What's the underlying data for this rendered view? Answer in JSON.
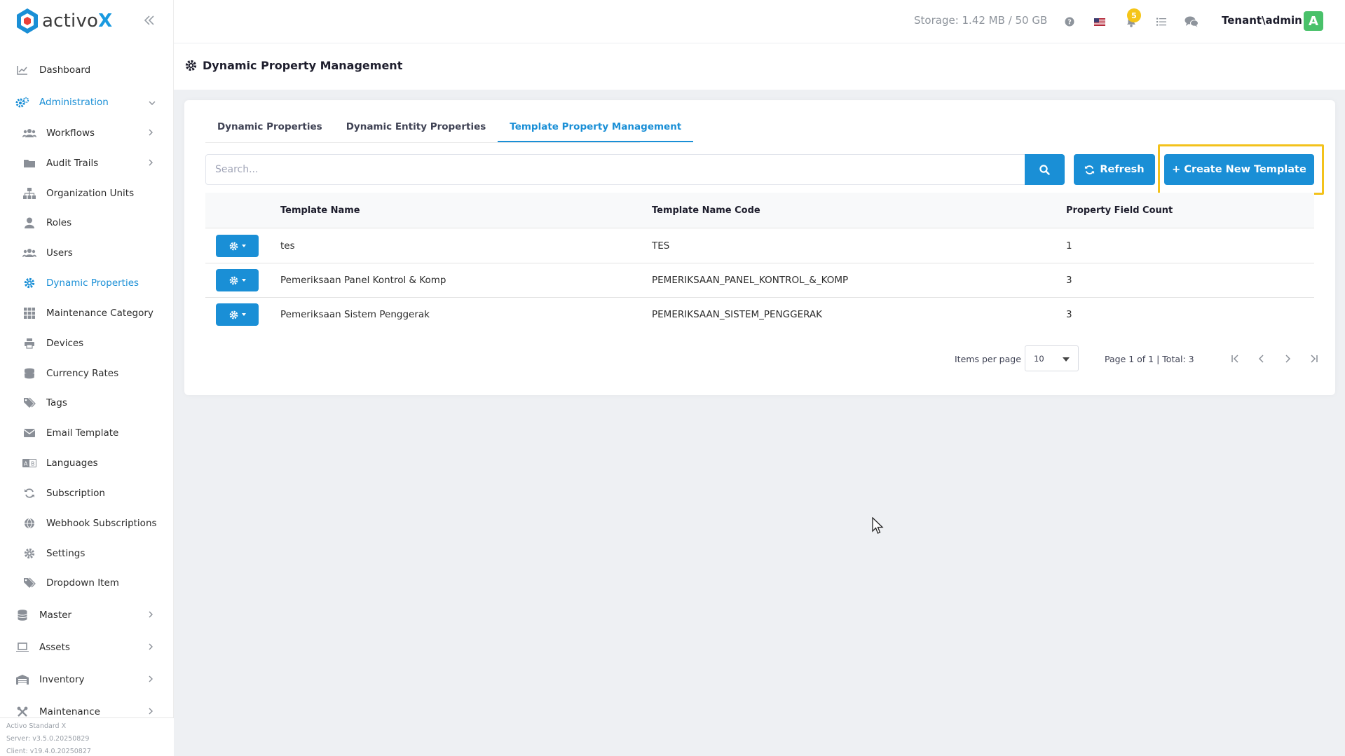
{
  "app": {
    "logo_text_prefix": "activo",
    "logo_text_suffix": "X",
    "brand_color": "#1a8fd6"
  },
  "sidebar": {
    "items": [
      {
        "label": "Dashboard",
        "icon": "chart-line-icon"
      },
      {
        "label": "Administration",
        "icon": "cogs-icon"
      },
      {
        "label": "Workflows",
        "icon": "users-icon"
      },
      {
        "label": "Audit Trails",
        "icon": "folder-icon"
      },
      {
        "label": "Organization Units",
        "icon": "sitemap-icon"
      },
      {
        "label": "Roles",
        "icon": "user-tie-icon"
      },
      {
        "label": "Users",
        "icon": "users-icon"
      },
      {
        "label": "Dynamic Properties",
        "icon": "gear-icon"
      },
      {
        "label": "Maintenance Category",
        "icon": "grid-icon"
      },
      {
        "label": "Devices",
        "icon": "printer-icon"
      },
      {
        "label": "Currency Rates",
        "icon": "coins-icon"
      },
      {
        "label": "Tags",
        "icon": "tags-icon"
      },
      {
        "label": "Email Template",
        "icon": "envelope-icon"
      },
      {
        "label": "Languages",
        "icon": "language-icon"
      },
      {
        "label": "Subscription",
        "icon": "sync-icon"
      },
      {
        "label": "Webhook Subscriptions",
        "icon": "globe-icon"
      },
      {
        "label": "Settings",
        "icon": "gear-icon"
      },
      {
        "label": "Dropdown Item",
        "icon": "tags-icon"
      },
      {
        "label": "Master",
        "icon": "database-icon"
      },
      {
        "label": "Assets",
        "icon": "laptop-icon"
      },
      {
        "label": "Inventory",
        "icon": "warehouse-icon"
      },
      {
        "label": "Maintenance",
        "icon": "tools-icon"
      }
    ],
    "footer": {
      "edition": "Activo Standard X",
      "server": "Server: v3.5.0.20250829",
      "client": "Client: v19.4.0.20250827"
    }
  },
  "topbar": {
    "storage": "Storage: 1.42 MB / 50 GB",
    "notification_count": "5",
    "user": "Tenant\\admin",
    "avatar_letter": "A"
  },
  "page": {
    "title": "Dynamic Property Management"
  },
  "tabs": [
    {
      "label": "Dynamic Properties"
    },
    {
      "label": "Dynamic Entity Properties"
    },
    {
      "label": "Template Property Management"
    }
  ],
  "toolbar": {
    "search_placeholder": "Search...",
    "refresh_label": "Refresh",
    "create_label": "+ Create New Template"
  },
  "table": {
    "columns": [
      "Template Name",
      "Template Name Code",
      "Property Field Count"
    ],
    "rows": [
      {
        "name": "tes",
        "code": "TES",
        "count": "1"
      },
      {
        "name": "Pemeriksaan Panel Kontrol & Komp",
        "code": "PEMERIKSAAN_PANEL_KONTROL_&_KOMP",
        "count": "3"
      },
      {
        "name": "Pemeriksaan Sistem Penggerak",
        "code": "PEMERIKSAAN_SISTEM_PENGGERAK",
        "count": "3"
      }
    ]
  },
  "pager": {
    "items_per_page_label": "Items per page",
    "items_per_page_value": "10",
    "page_info": "Page 1 of 1 | Total: 3"
  }
}
